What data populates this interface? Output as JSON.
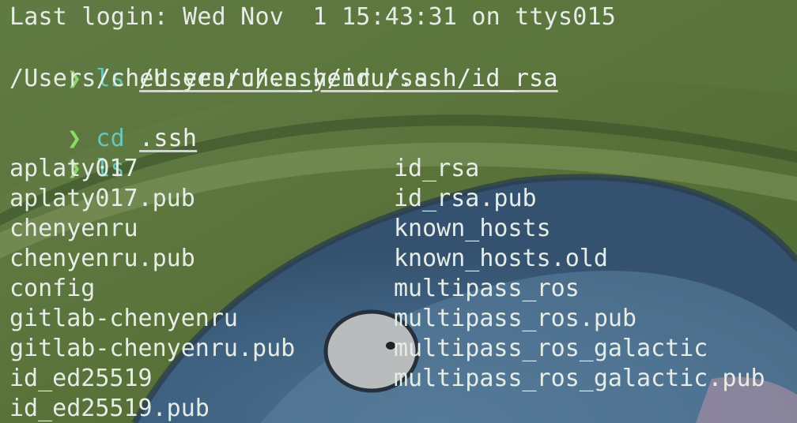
{
  "terminal": {
    "login_line": "Last login: Wed Nov  1 15:43:31 on ttys015",
    "prompt_symbol": "❯",
    "commands": [
      {
        "cmd": "ls",
        "arg": "/Users/chen_yenru/.ssh/id_rsa"
      },
      {
        "cmd": "cd",
        "arg": ".ssh"
      },
      {
        "cmd": "ls",
        "arg": ""
      }
    ],
    "output_path": "/Users/chen_yenru/.ssh/id_rsa",
    "listing_left": [
      "aplaty017",
      "aplaty017.pub",
      "chenyenru",
      "chenyenru.pub",
      "config",
      "gitlab-chenyenru",
      "gitlab-chenyenru.pub",
      "id_ed25519",
      "id_ed25519.pub"
    ],
    "listing_right": [
      "id_rsa",
      "id_rsa.pub",
      "known_hosts",
      "known_hosts.old",
      "multipass_ros",
      "multipass_ros.pub",
      "multipass_ros_galactic",
      "multipass_ros_galactic.pub"
    ]
  },
  "colors": {
    "prompt": "#8fd96a",
    "command": "#69c7b8",
    "text": "#e6ece6",
    "background": "#6f8a48"
  }
}
